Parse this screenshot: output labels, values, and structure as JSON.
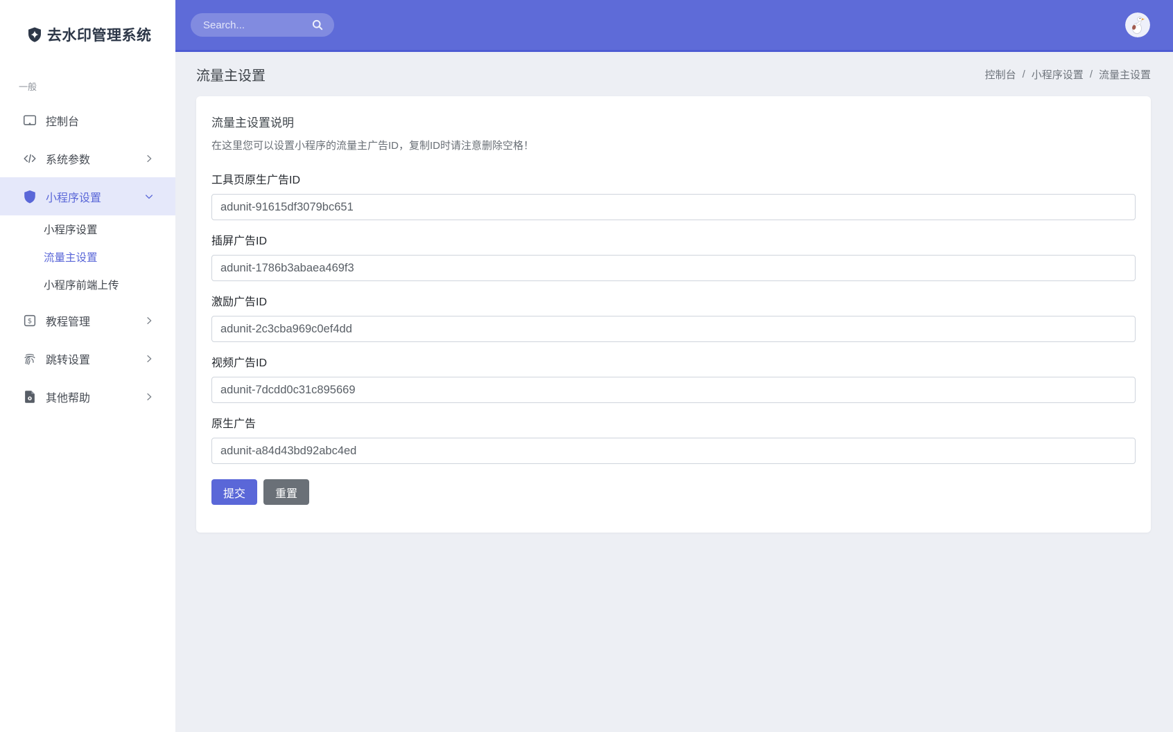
{
  "app_title": "去水印管理系统",
  "topbar": {
    "search_placeholder": "Search..."
  },
  "sidebar": {
    "section_label": "一般",
    "items": [
      {
        "label": "控制台",
        "icon": "console-icon"
      },
      {
        "label": "系统参数",
        "icon": "code-icon",
        "chevron": "right"
      },
      {
        "label": "小程序设置",
        "icon": "shield-icon",
        "chevron": "down",
        "active": true,
        "children": [
          {
            "label": "小程序设置",
            "active": false
          },
          {
            "label": "流量主设置",
            "active": true
          },
          {
            "label": "小程序前端上传",
            "active": false
          }
        ]
      },
      {
        "label": "教程管理",
        "icon": "dollar-square-icon",
        "chevron": "right"
      },
      {
        "label": "跳转设置",
        "icon": "fingerprint-icon",
        "chevron": "right"
      },
      {
        "label": "其他帮助",
        "icon": "file-code-icon",
        "chevron": "right"
      }
    ]
  },
  "header": {
    "title": "流量主设置",
    "breadcrumb": {
      "items": [
        "控制台",
        "小程序设置",
        "流量主设置"
      ],
      "separator": "/"
    }
  },
  "card": {
    "heading": "流量主设置说明",
    "description": "在这里您可以设置小程序的流量主广告ID，复制ID时请注意删除空格！",
    "fields": [
      {
        "label": "工具页原生广告ID",
        "value": "adunit-91615df3079bc651"
      },
      {
        "label": "插屏广告ID",
        "value": "adunit-1786b3abaea469f3"
      },
      {
        "label": "激励广告ID",
        "value": "adunit-2c3cba969c0ef4dd"
      },
      {
        "label": "视频广告ID",
        "value": "adunit-7dcdd0c31c895669"
      },
      {
        "label": "原生广告",
        "value": "adunit-a84d43bd92abc4ed"
      }
    ],
    "buttons": {
      "submit": "提交",
      "reset": "重置"
    }
  },
  "colors": {
    "accent": "#5a67d8",
    "topbar": "#5e6bd8",
    "topbar_border": "#4d5bd3",
    "sidebar_active_bg": "#e5e8fa",
    "reset_button": "#6a7077",
    "content_bg": "#edeff4",
    "logo_text": "#2d3748"
  }
}
